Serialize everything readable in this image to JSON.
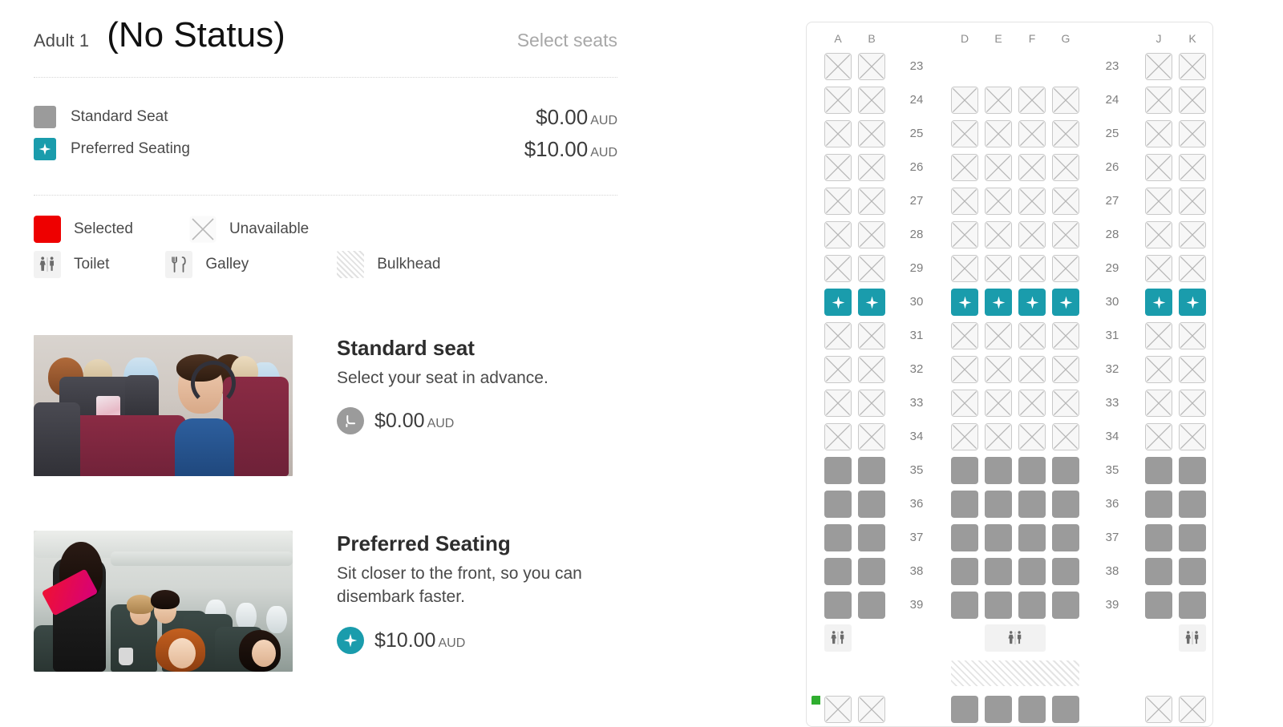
{
  "header": {
    "passenger_label": "Adult 1",
    "status": "(No Status)",
    "action": "Select seats"
  },
  "price_legend": {
    "items": [
      {
        "name": "Standard Seat",
        "amount": "$0.00",
        "currency": "AUD",
        "swatch": "standard-seat-swatch",
        "color": "#9b9b9b"
      },
      {
        "name": "Preferred Seating",
        "amount": "$10.00",
        "currency": "AUD",
        "swatch": "preferred-seat-swatch",
        "color": "#1a9cac"
      }
    ]
  },
  "status_legend": {
    "items": [
      {
        "label": "Selected",
        "icon": "selected-seat-swatch",
        "color": "#ee0000"
      },
      {
        "label": "Unavailable",
        "icon": "unavailable-seat-icon"
      },
      {
        "label": "Toilet",
        "icon": "toilet-icon"
      },
      {
        "label": "Galley",
        "icon": "galley-icon"
      },
      {
        "label": "Bulkhead",
        "icon": "bulkhead-swatch"
      }
    ]
  },
  "products": [
    {
      "title": "Standard seat",
      "description": "Select your seat in advance.",
      "price": "$0.00",
      "currency": "AUD",
      "badge_icon": "seat-icon",
      "badge_color": "#9b9b9b",
      "photo_alt": "Passengers seated in aircraft cabin watching seat-back entertainment screens"
    },
    {
      "title": "Preferred Seating",
      "description": "Sit closer to the front, so you can disembark faster.",
      "price": "$10.00",
      "currency": "AUD",
      "badge_icon": "star-icon",
      "badge_color": "#1a9cac",
      "photo_alt": "Cabin crew member serving drinks to smiling passengers in the cabin aisle"
    }
  ],
  "seatmap": {
    "columns_left": [
      "A",
      "B"
    ],
    "columns_center": [
      "D",
      "E",
      "F",
      "G"
    ],
    "columns_right": [
      "J",
      "K"
    ],
    "colors": {
      "available": "#9b9b9b",
      "preferred": "#1a9cac",
      "unavailable_fill": "#f7f7f7",
      "unavailable_border": "#c9c9c9",
      "selected": "#ee0000"
    },
    "rows": [
      {
        "number": "23",
        "left": [
          "unavailable",
          "unavailable"
        ],
        "center": [],
        "right": [
          "unavailable",
          "unavailable"
        ]
      },
      {
        "number": "24",
        "left": [
          "unavailable",
          "unavailable"
        ],
        "center": [
          "unavailable",
          "unavailable",
          "unavailable",
          "unavailable"
        ],
        "right": [
          "unavailable",
          "unavailable"
        ]
      },
      {
        "number": "25",
        "left": [
          "unavailable",
          "unavailable"
        ],
        "center": [
          "unavailable",
          "unavailable",
          "unavailable",
          "unavailable"
        ],
        "right": [
          "unavailable",
          "unavailable"
        ]
      },
      {
        "number": "26",
        "left": [
          "unavailable",
          "unavailable"
        ],
        "center": [
          "unavailable",
          "unavailable",
          "unavailable",
          "unavailable"
        ],
        "right": [
          "unavailable",
          "unavailable"
        ]
      },
      {
        "number": "27",
        "left": [
          "unavailable",
          "unavailable"
        ],
        "center": [
          "unavailable",
          "unavailable",
          "unavailable",
          "unavailable"
        ],
        "right": [
          "unavailable",
          "unavailable"
        ]
      },
      {
        "number": "28",
        "left": [
          "unavailable",
          "unavailable"
        ],
        "center": [
          "unavailable",
          "unavailable",
          "unavailable",
          "unavailable"
        ],
        "right": [
          "unavailable",
          "unavailable"
        ]
      },
      {
        "number": "29",
        "left": [
          "unavailable",
          "unavailable"
        ],
        "center": [
          "unavailable",
          "unavailable",
          "unavailable",
          "unavailable"
        ],
        "right": [
          "unavailable",
          "unavailable"
        ]
      },
      {
        "number": "30",
        "left": [
          "preferred",
          "preferred"
        ],
        "center": [
          "preferred",
          "preferred",
          "preferred",
          "preferred"
        ],
        "right": [
          "preferred",
          "preferred"
        ]
      },
      {
        "number": "31",
        "left": [
          "unavailable",
          "unavailable"
        ],
        "center": [
          "unavailable",
          "unavailable",
          "unavailable",
          "unavailable"
        ],
        "right": [
          "unavailable",
          "unavailable"
        ]
      },
      {
        "number": "32",
        "left": [
          "unavailable",
          "unavailable"
        ],
        "center": [
          "unavailable",
          "unavailable",
          "unavailable",
          "unavailable"
        ],
        "right": [
          "unavailable",
          "unavailable"
        ]
      },
      {
        "number": "33",
        "left": [
          "unavailable",
          "unavailable"
        ],
        "center": [
          "unavailable",
          "unavailable",
          "unavailable",
          "unavailable"
        ],
        "right": [
          "unavailable",
          "unavailable"
        ]
      },
      {
        "number": "34",
        "left": [
          "unavailable",
          "unavailable"
        ],
        "center": [
          "unavailable",
          "unavailable",
          "unavailable",
          "unavailable"
        ],
        "right": [
          "unavailable",
          "unavailable"
        ]
      },
      {
        "number": "35",
        "left": [
          "available",
          "available"
        ],
        "center": [
          "available",
          "available",
          "available",
          "available"
        ],
        "right": [
          "available",
          "available"
        ]
      },
      {
        "number": "36",
        "left": [
          "available",
          "available"
        ],
        "center": [
          "available",
          "available",
          "available",
          "available"
        ],
        "right": [
          "available",
          "available"
        ]
      },
      {
        "number": "37",
        "left": [
          "available",
          "available"
        ],
        "center": [
          "available",
          "available",
          "available",
          "available"
        ],
        "right": [
          "available",
          "available"
        ]
      },
      {
        "number": "38",
        "left": [
          "available",
          "available"
        ],
        "center": [
          "available",
          "available",
          "available",
          "available"
        ],
        "right": [
          "available",
          "available"
        ]
      },
      {
        "number": "39",
        "left": [
          "available",
          "available"
        ],
        "center": [
          "available",
          "available",
          "available",
          "available"
        ],
        "right": [
          "available",
          "available"
        ]
      }
    ],
    "facilities": [
      {
        "type": "toilet",
        "position": "left"
      },
      {
        "type": "toilet",
        "position": "center"
      },
      {
        "type": "toilet",
        "position": "right"
      }
    ],
    "bulkhead": {
      "position": "center"
    },
    "partial_row_below": {
      "left": [
        "unavailable",
        "unavailable"
      ],
      "center": [
        "available",
        "available",
        "available",
        "available"
      ],
      "right": [
        "unavailable",
        "unavailable"
      ]
    }
  }
}
